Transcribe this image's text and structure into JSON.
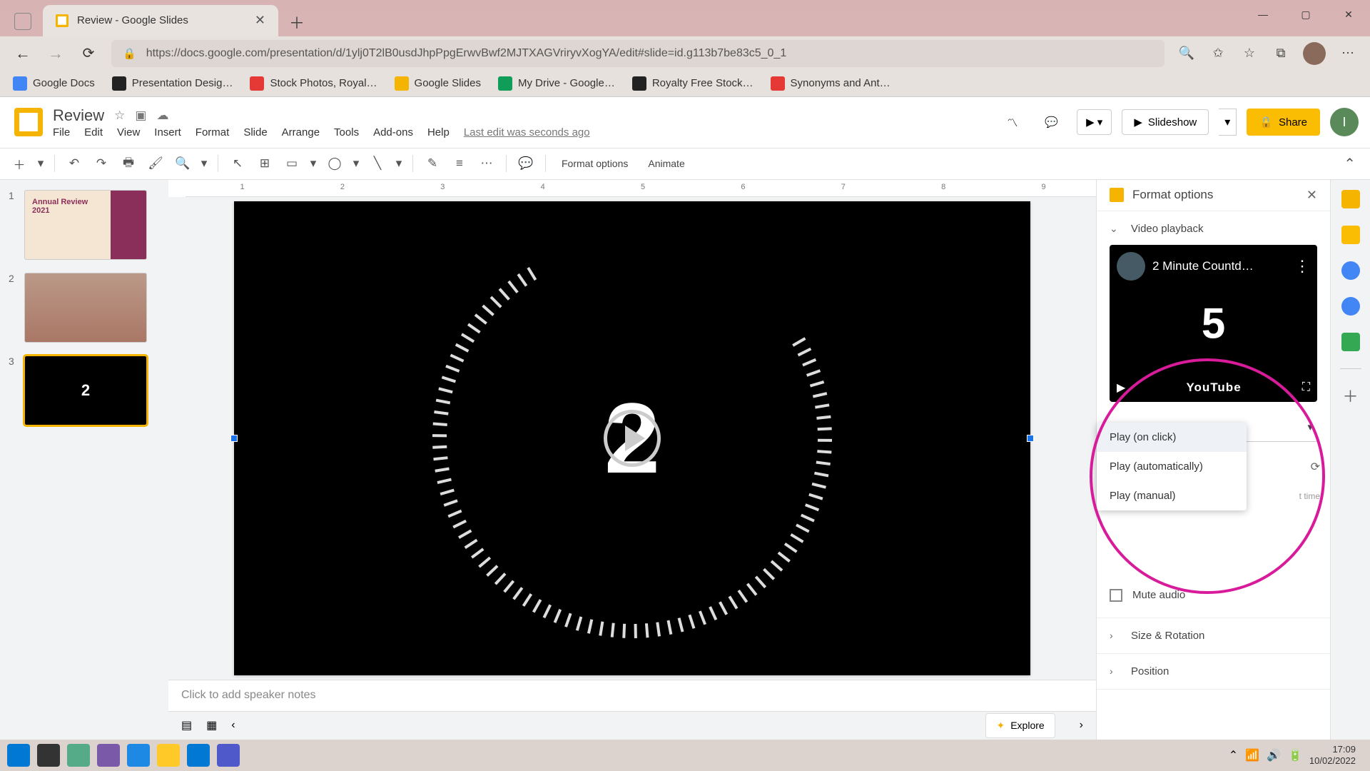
{
  "browser": {
    "tab_title": "Review - Google Slides",
    "url": "https://docs.google.com/presentation/d/1ylj0T2lB0usdJhpPpgErwvBwf2MJTXAGVriryvXogYA/edit#slide=id.g113b7be83c5_0_1"
  },
  "bookmarks": [
    {
      "label": "Google Docs",
      "color": "#4285f4"
    },
    {
      "label": "Presentation Desig…",
      "color": "#222"
    },
    {
      "label": "Stock Photos, Royal…",
      "color": "#e53935"
    },
    {
      "label": "Google Slides",
      "color": "#f4b400"
    },
    {
      "label": "My Drive - Google…",
      "color": "#0f9d58"
    },
    {
      "label": "Royalty Free Stock…",
      "color": "#222"
    },
    {
      "label": "Synonyms and Ant…",
      "color": "#e53935"
    }
  ],
  "doc": {
    "title": "Review",
    "menus": [
      "File",
      "Edit",
      "View",
      "Insert",
      "Format",
      "Slide",
      "Arrange",
      "Tools",
      "Add-ons",
      "Help"
    ],
    "last_edit": "Last edit was seconds ago"
  },
  "header_buttons": {
    "slideshow": "Slideshow",
    "share": "Share",
    "profile_initial": "I"
  },
  "toolbar": {
    "format_options": "Format options",
    "animate": "Animate"
  },
  "thumbs": [
    {
      "n": "1",
      "title": "Annual Review 2021"
    },
    {
      "n": "2",
      "title": ""
    },
    {
      "n": "3",
      "title": ""
    }
  ],
  "slide": {
    "big_number": "2"
  },
  "notes_placeholder": "Click to add speaker notes",
  "sidepanel": {
    "title": "Format options",
    "sections": {
      "video_playback": "Video playback",
      "size_rotation": "Size & Rotation",
      "position": "Position"
    },
    "video_title": "2 Minute Countd…",
    "video_preview_number": "5",
    "youtube": "YouTube",
    "play_select": "Play (on click)",
    "play_options": [
      "Play (on click)",
      "Play (automatically)",
      "Play (manual)"
    ],
    "mute": "Mute audio",
    "time_hint": "t time"
  },
  "explore": "Explore",
  "clock": {
    "time": "17:09",
    "date": "10/02/2022"
  }
}
